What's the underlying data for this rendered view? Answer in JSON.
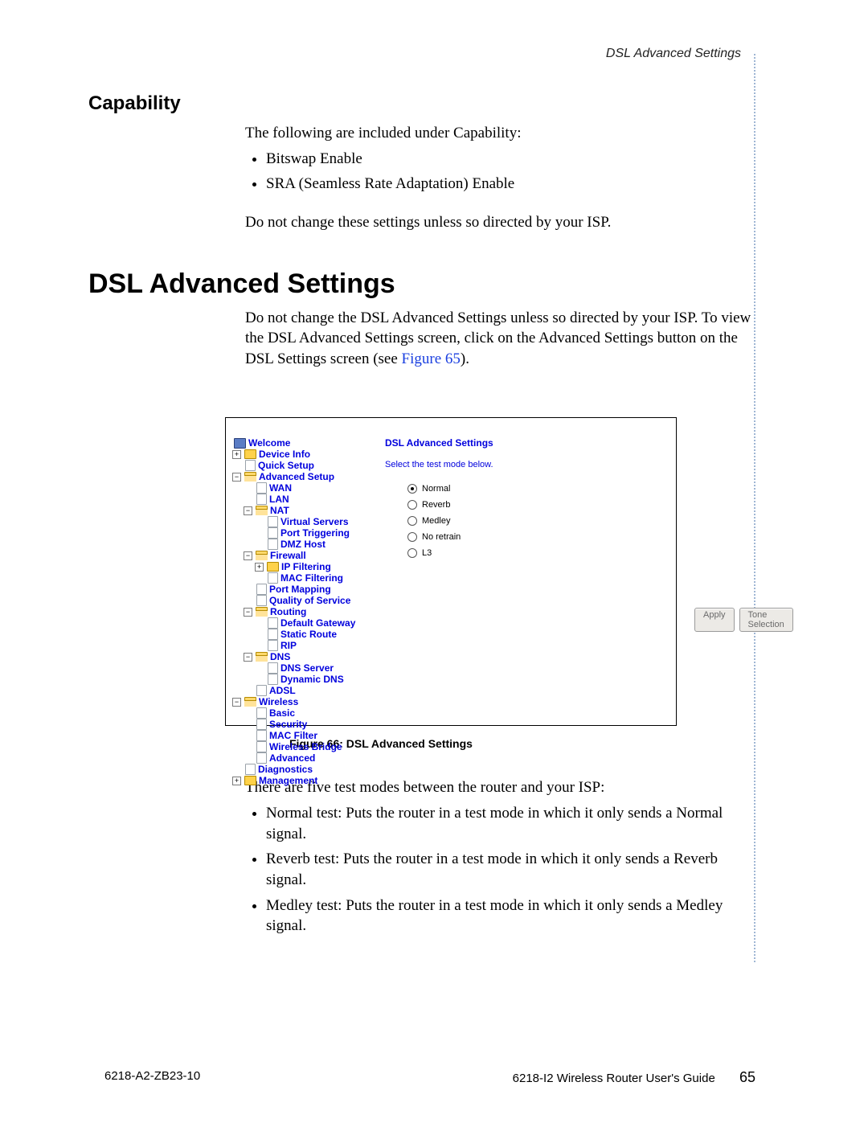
{
  "running_head": "DSL Advanced Settings",
  "section_capability": {
    "title": "Capability",
    "intro": "The following are included under Capability:",
    "bullets": [
      "Bitswap Enable",
      "SRA (Seamless Rate Adaptation) Enable"
    ],
    "note": "Do not change these settings unless so directed by your ISP."
  },
  "section_dsl": {
    "title": "DSL Advanced Settings",
    "para_before_link": "Do not change the DSL Advanced Settings unless so directed by your ISP. To view the DSL Advanced Settings screen, click on the Advanced Settings button on the DSL Settings screen (see ",
    "link_text": "Figure 65",
    "para_after_link": ")."
  },
  "figure": {
    "caption": "Figure 66: DSL Advanced Settings",
    "tree": [
      {
        "depth": 0,
        "pm": "",
        "icon": "monitor",
        "label": "Welcome"
      },
      {
        "depth": 0,
        "pm": "+",
        "icon": "folder-closed",
        "label": "Device Info"
      },
      {
        "depth": 1,
        "pm": "",
        "icon": "page",
        "label": "Quick Setup"
      },
      {
        "depth": 0,
        "pm": "-",
        "icon": "folder-open",
        "label": "Advanced Setup"
      },
      {
        "depth": 2,
        "pm": "",
        "icon": "page",
        "label": "WAN"
      },
      {
        "depth": 2,
        "pm": "",
        "icon": "page",
        "label": "LAN"
      },
      {
        "depth": 1,
        "pm": "-",
        "icon": "folder-open",
        "label": "NAT"
      },
      {
        "depth": 3,
        "pm": "",
        "icon": "page",
        "label": "Virtual Servers"
      },
      {
        "depth": 3,
        "pm": "",
        "icon": "page",
        "label": "Port Triggering"
      },
      {
        "depth": 3,
        "pm": "",
        "icon": "page",
        "label": "DMZ Host"
      },
      {
        "depth": 1,
        "pm": "-",
        "icon": "folder-open",
        "label": "Firewall"
      },
      {
        "depth": 2,
        "pm": "+",
        "icon": "folder-closed",
        "label": "IP Filtering"
      },
      {
        "depth": 3,
        "pm": "",
        "icon": "page",
        "label": "MAC Filtering"
      },
      {
        "depth": 2,
        "pm": "",
        "icon": "page",
        "label": "Port Mapping"
      },
      {
        "depth": 2,
        "pm": "",
        "icon": "page",
        "label": "Quality of Service"
      },
      {
        "depth": 1,
        "pm": "-",
        "icon": "folder-open",
        "label": "Routing"
      },
      {
        "depth": 3,
        "pm": "",
        "icon": "page",
        "label": "Default Gateway"
      },
      {
        "depth": 3,
        "pm": "",
        "icon": "page",
        "label": "Static Route"
      },
      {
        "depth": 3,
        "pm": "",
        "icon": "page",
        "label": "RIP"
      },
      {
        "depth": 1,
        "pm": "-",
        "icon": "folder-open",
        "label": "DNS"
      },
      {
        "depth": 3,
        "pm": "",
        "icon": "page",
        "label": "DNS Server"
      },
      {
        "depth": 3,
        "pm": "",
        "icon": "page",
        "label": "Dynamic DNS"
      },
      {
        "depth": 2,
        "pm": "",
        "icon": "page",
        "label": "ADSL"
      },
      {
        "depth": 0,
        "pm": "-",
        "icon": "folder-open",
        "label": "Wireless"
      },
      {
        "depth": 2,
        "pm": "",
        "icon": "page",
        "label": "Basic"
      },
      {
        "depth": 2,
        "pm": "",
        "icon": "page",
        "label": "Security"
      },
      {
        "depth": 2,
        "pm": "",
        "icon": "page",
        "label": "MAC Filter"
      },
      {
        "depth": 2,
        "pm": "",
        "icon": "page",
        "label": "Wireless Bridge"
      },
      {
        "depth": 2,
        "pm": "",
        "icon": "page",
        "label": "Advanced"
      },
      {
        "depth": 1,
        "pm": "",
        "icon": "page",
        "label": "Diagnostics"
      },
      {
        "depth": 0,
        "pm": "+",
        "icon": "folder-closed",
        "label": "Management"
      }
    ],
    "content": {
      "title": "DSL Advanced Settings",
      "instruction": "Select the test mode below.",
      "options": [
        {
          "label": "Normal",
          "checked": true
        },
        {
          "label": "Reverb",
          "checked": false
        },
        {
          "label": "Medley",
          "checked": false
        },
        {
          "label": "No retrain",
          "checked": false
        },
        {
          "label": "L3",
          "checked": false
        }
      ],
      "buttons": {
        "apply": "Apply",
        "tone": "Tone Selection"
      }
    }
  },
  "after_figure": {
    "intro": "There are five test modes between the router and your ISP:",
    "bullets": [
      "Normal test: Puts the router in a test mode in which it only sends a Normal signal.",
      "Reverb test: Puts the router in a test mode in which it only sends a Reverb signal.",
      "Medley test: Puts the router in a test mode in which it only sends a Medley signal."
    ]
  },
  "footer": {
    "left": "6218-A2-ZB23-10",
    "right": "6218-I2 Wireless Router User's Guide",
    "page": "65"
  }
}
